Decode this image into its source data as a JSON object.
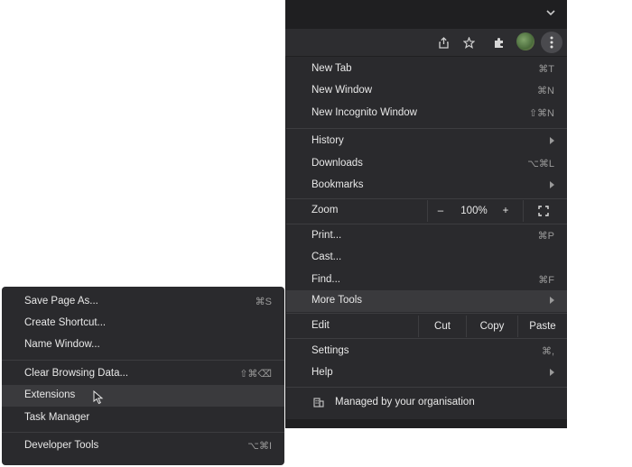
{
  "browser": {
    "colors": {
      "background": "#1f1f21",
      "toolbar": "#2d2d30",
      "menu": "#2a2a2d",
      "highlight": "#3a3a3d",
      "text": "#e8e8e8",
      "shortcut": "#9a9a9a"
    },
    "toolbar_icons": [
      "share-icon",
      "bookmark-star-icon",
      "extensions-puzzle-icon",
      "profile-avatar",
      "more-menu-kebab-icon"
    ]
  },
  "main_menu": {
    "new_tab": {
      "label": "New Tab",
      "shortcut": "⌘T"
    },
    "new_window": {
      "label": "New Window",
      "shortcut": "⌘N"
    },
    "new_incognito": {
      "label": "New Incognito Window",
      "shortcut": "⇧⌘N"
    },
    "history": {
      "label": "History"
    },
    "downloads": {
      "label": "Downloads",
      "shortcut": "⌥⌘L"
    },
    "bookmarks": {
      "label": "Bookmarks"
    },
    "zoom": {
      "label": "Zoom",
      "minus": "–",
      "value": "100%",
      "plus": "+"
    },
    "print": {
      "label": "Print...",
      "shortcut": "⌘P"
    },
    "cast": {
      "label": "Cast..."
    },
    "find": {
      "label": "Find...",
      "shortcut": "⌘F"
    },
    "more_tools": {
      "label": "More Tools"
    },
    "edit": {
      "label": "Edit",
      "cut": "Cut",
      "copy": "Copy",
      "paste": "Paste"
    },
    "settings": {
      "label": "Settings",
      "shortcut": "⌘,"
    },
    "help": {
      "label": "Help"
    },
    "managed": {
      "label": "Managed by your organisation"
    }
  },
  "more_tools_menu": {
    "save_page": {
      "label": "Save Page As...",
      "shortcut": "⌘S"
    },
    "create_shortcut": {
      "label": "Create Shortcut..."
    },
    "name_window": {
      "label": "Name Window..."
    },
    "clear_data": {
      "label": "Clear Browsing Data...",
      "shortcut": "⇧⌘⌫"
    },
    "extensions": {
      "label": "Extensions"
    },
    "task_manager": {
      "label": "Task Manager"
    },
    "developer_tools": {
      "label": "Developer Tools",
      "shortcut": "⌥⌘I"
    }
  }
}
